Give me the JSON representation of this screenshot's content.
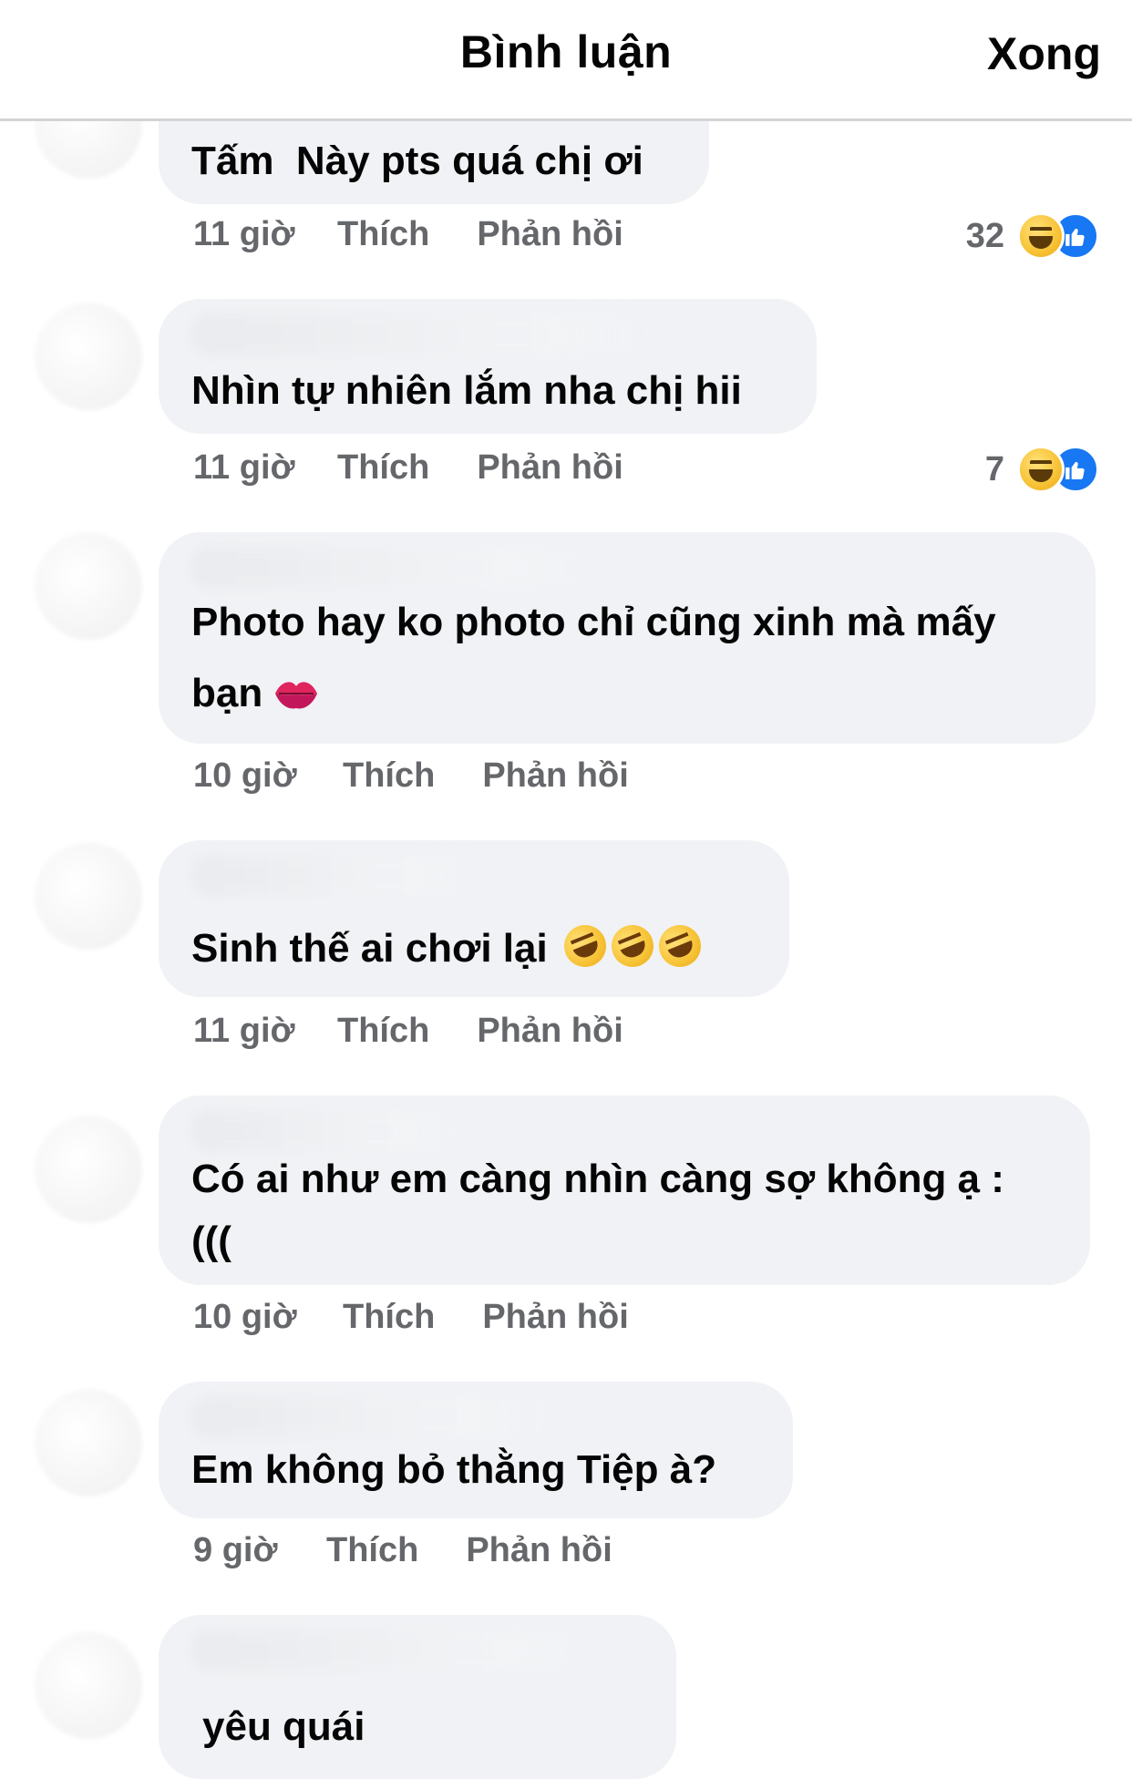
{
  "header": {
    "title": "Bình luận",
    "done_label": "Xong"
  },
  "actions": {
    "like_label": "Thích",
    "reply_label": "Phản hồi"
  },
  "comments": [
    {
      "text": "Tấm  Này pts quá chị ơi",
      "time": "11 giờ",
      "reaction_count": "32",
      "reactions": [
        "haha-icon",
        "like-icon"
      ]
    },
    {
      "text": "Nhìn tự nhiên lắm nha chị hii",
      "time": "11 giờ",
      "reaction_count": "7",
      "reactions": [
        "haha-icon",
        "like-icon"
      ]
    },
    {
      "text": "Photo hay ko photo chỉ cũng xinh mà mấy\nbạn",
      "time": "10 giờ",
      "emoji": "kiss-mark-icon"
    },
    {
      "text": "Sinh thế ai chơi lại",
      "time": "11 giờ",
      "emoji": "rolling-laughing-icon x3"
    },
    {
      "text": "Có ai như em càng nhìn càng sợ không ạ :\n(((",
      "time": "10 giờ"
    },
    {
      "text": "Em không bỏ thằng Tiệp à?",
      "time": "9 giờ"
    },
    {
      "text": "yêu quái"
    }
  ],
  "colors": {
    "bubble": "#f0f2f5",
    "meta": "#65676b",
    "like_blue": "#1877f2"
  }
}
